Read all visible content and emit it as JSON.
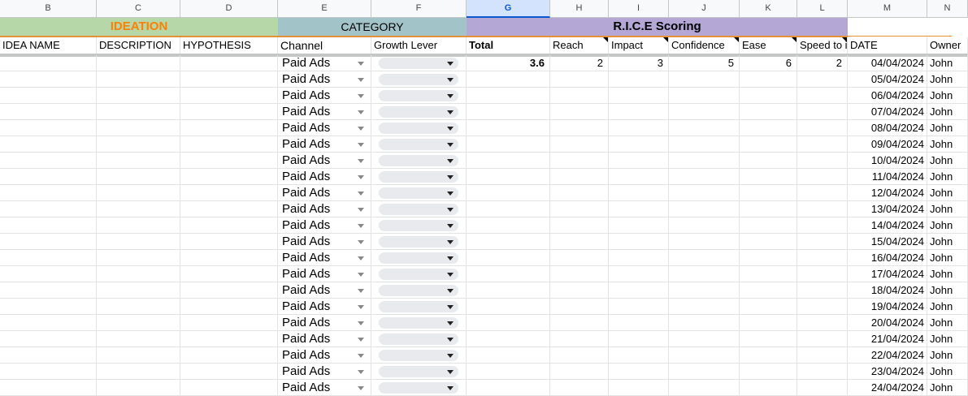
{
  "column_headers": [
    "B",
    "C",
    "D",
    "E",
    "F",
    "G",
    "H",
    "I",
    "J",
    "K",
    "L",
    "M",
    "N"
  ],
  "groups": {
    "ideation": "IDEATION",
    "category": "CATEGORY",
    "rice": "R.I.C.E Scoring"
  },
  "labels": {
    "idea_name": "IDEA NAME",
    "description": "DESCRIPTION",
    "hypothesis": "HYPOTHESIS",
    "channel": "Channel",
    "growth_lever": "Growth Lever",
    "total": "Total",
    "reach": "Reach",
    "impact": "Impact",
    "confidence": "Confidence",
    "ease": "Ease",
    "speed": "Speed to i",
    "date": "DATE",
    "owner": "Owner"
  },
  "colors": {
    "ideation_bg": "#b6d7a8",
    "ideation_text": "#ff7f00",
    "category_bg": "#a2c4c9",
    "rice_bg": "#b4a7d6",
    "divider": "#e69138",
    "selected_col": "#d3e3fd"
  },
  "rows": [
    {
      "channel": "Paid Ads",
      "total": "3.6",
      "reach": "2",
      "impact": "3",
      "confidence": "5",
      "ease": "6",
      "speed": "2",
      "date": "04/04/2024",
      "owner": "John"
    },
    {
      "channel": "Paid Ads",
      "total": "",
      "reach": "",
      "impact": "",
      "confidence": "",
      "ease": "",
      "speed": "",
      "date": "05/04/2024",
      "owner": "John"
    },
    {
      "channel": "Paid Ads",
      "total": "",
      "reach": "",
      "impact": "",
      "confidence": "",
      "ease": "",
      "speed": "",
      "date": "06/04/2024",
      "owner": "John"
    },
    {
      "channel": "Paid Ads",
      "total": "",
      "reach": "",
      "impact": "",
      "confidence": "",
      "ease": "",
      "speed": "",
      "date": "07/04/2024",
      "owner": "John"
    },
    {
      "channel": "Paid Ads",
      "total": "",
      "reach": "",
      "impact": "",
      "confidence": "",
      "ease": "",
      "speed": "",
      "date": "08/04/2024",
      "owner": "John"
    },
    {
      "channel": "Paid Ads",
      "total": "",
      "reach": "",
      "impact": "",
      "confidence": "",
      "ease": "",
      "speed": "",
      "date": "09/04/2024",
      "owner": "John"
    },
    {
      "channel": "Paid Ads",
      "total": "",
      "reach": "",
      "impact": "",
      "confidence": "",
      "ease": "",
      "speed": "",
      "date": "10/04/2024",
      "owner": "John"
    },
    {
      "channel": "Paid Ads",
      "total": "",
      "reach": "",
      "impact": "",
      "confidence": "",
      "ease": "",
      "speed": "",
      "date": "11/04/2024",
      "owner": "John"
    },
    {
      "channel": "Paid Ads",
      "total": "",
      "reach": "",
      "impact": "",
      "confidence": "",
      "ease": "",
      "speed": "",
      "date": "12/04/2024",
      "owner": "John"
    },
    {
      "channel": "Paid Ads",
      "total": "",
      "reach": "",
      "impact": "",
      "confidence": "",
      "ease": "",
      "speed": "",
      "date": "13/04/2024",
      "owner": "John"
    },
    {
      "channel": "Paid Ads",
      "total": "",
      "reach": "",
      "impact": "",
      "confidence": "",
      "ease": "",
      "speed": "",
      "date": "14/04/2024",
      "owner": "John"
    },
    {
      "channel": "Paid Ads",
      "total": "",
      "reach": "",
      "impact": "",
      "confidence": "",
      "ease": "",
      "speed": "",
      "date": "15/04/2024",
      "owner": "John"
    },
    {
      "channel": "Paid Ads",
      "total": "",
      "reach": "",
      "impact": "",
      "confidence": "",
      "ease": "",
      "speed": "",
      "date": "16/04/2024",
      "owner": "John"
    },
    {
      "channel": "Paid Ads",
      "total": "",
      "reach": "",
      "impact": "",
      "confidence": "",
      "ease": "",
      "speed": "",
      "date": "17/04/2024",
      "owner": "John"
    },
    {
      "channel": "Paid Ads",
      "total": "",
      "reach": "",
      "impact": "",
      "confidence": "",
      "ease": "",
      "speed": "",
      "date": "18/04/2024",
      "owner": "John"
    },
    {
      "channel": "Paid Ads",
      "total": "",
      "reach": "",
      "impact": "",
      "confidence": "",
      "ease": "",
      "speed": "",
      "date": "19/04/2024",
      "owner": "John"
    },
    {
      "channel": "Paid Ads",
      "total": "",
      "reach": "",
      "impact": "",
      "confidence": "",
      "ease": "",
      "speed": "",
      "date": "20/04/2024",
      "owner": "John"
    },
    {
      "channel": "Paid Ads",
      "total": "",
      "reach": "",
      "impact": "",
      "confidence": "",
      "ease": "",
      "speed": "",
      "date": "21/04/2024",
      "owner": "John"
    },
    {
      "channel": "Paid Ads",
      "total": "",
      "reach": "",
      "impact": "",
      "confidence": "",
      "ease": "",
      "speed": "",
      "date": "22/04/2024",
      "owner": "John"
    },
    {
      "channel": "Paid Ads",
      "total": "",
      "reach": "",
      "impact": "",
      "confidence": "",
      "ease": "",
      "speed": "",
      "date": "23/04/2024",
      "owner": "John"
    },
    {
      "channel": "Paid Ads",
      "total": "",
      "reach": "",
      "impact": "",
      "confidence": "",
      "ease": "",
      "speed": "",
      "date": "24/04/2024",
      "owner": "John"
    }
  ]
}
